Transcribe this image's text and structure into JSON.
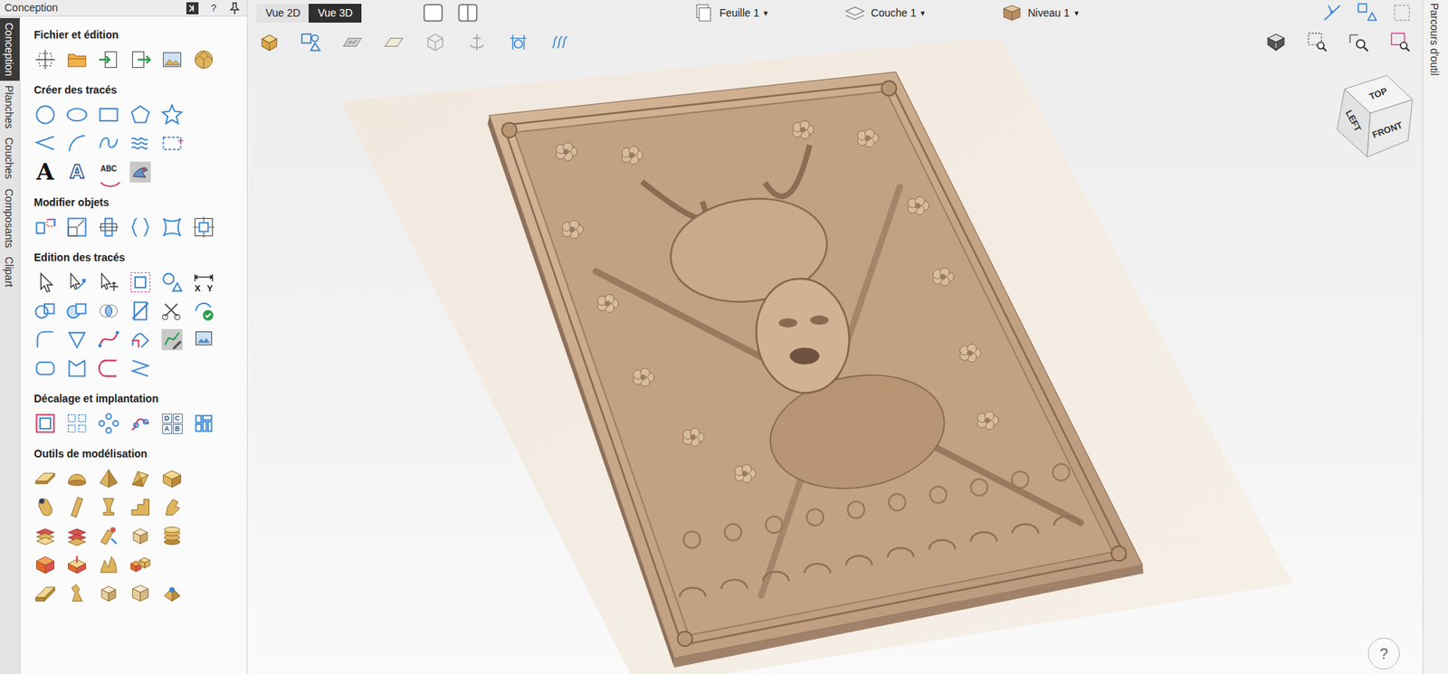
{
  "panel": {
    "title": "Conception",
    "help": "?"
  },
  "side_tabs": [
    {
      "label": "Conception",
      "selected": true
    },
    {
      "label": "Planches",
      "selected": false
    },
    {
      "label": "Couches",
      "selected": false
    },
    {
      "label": "Composants",
      "selected": false
    },
    {
      "label": "Clipart",
      "selected": false
    }
  ],
  "sections": [
    {
      "title": "Fichier et édition"
    },
    {
      "title": "Créer des tracés",
      "text_tools": [
        "A",
        "A",
        "ABC"
      ]
    },
    {
      "title": "Modifier objets"
    },
    {
      "title": "Edition des tracés",
      "text_tools": [
        "X",
        "Y"
      ]
    },
    {
      "title": "Décalage et implantation",
      "text_tools": [
        "D",
        "C",
        "A",
        "B"
      ]
    },
    {
      "title": "Outils de modélisation"
    }
  ],
  "view_buttons": [
    {
      "label": "Vue 2D",
      "selected": false
    },
    {
      "label": "Vue 3D",
      "selected": true
    }
  ],
  "dropdowns": [
    {
      "label": "Feuille 1",
      "caret": "▾"
    },
    {
      "label": "Couche 1",
      "caret": "▾"
    },
    {
      "label": "Niveau 1",
      "caret": "▾"
    }
  ],
  "view_cube": {
    "top": "TOP",
    "left": "LEFT",
    "front": "FRONT"
  },
  "help_button": "?",
  "right_tabs": [
    {
      "label": "Parcours d'outil",
      "selected": false
    }
  ]
}
